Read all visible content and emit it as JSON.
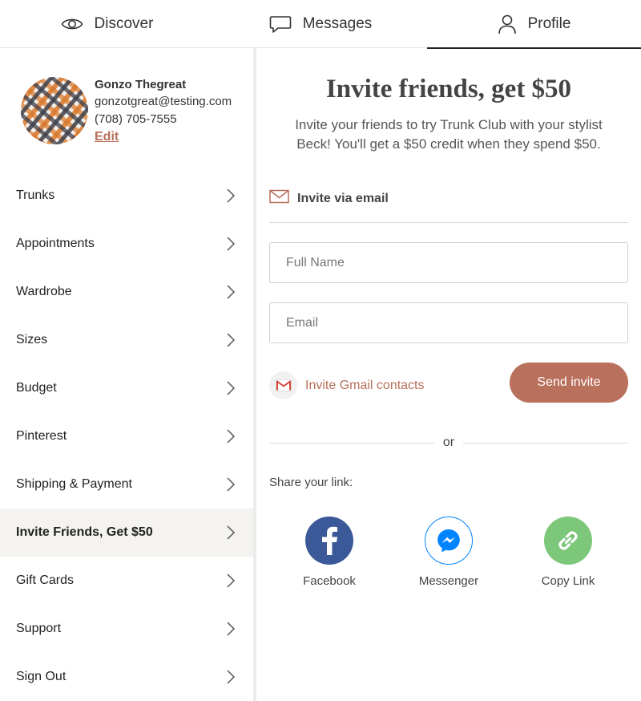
{
  "tabs": [
    {
      "label": "Discover",
      "icon": "eye-icon"
    },
    {
      "label": "Messages",
      "icon": "chat-bubble-icon"
    },
    {
      "label": "Profile",
      "icon": "person-icon",
      "active": true
    }
  ],
  "profile": {
    "name": "Gonzo Thegreat",
    "email": "gonzotgreat@testing.com",
    "phone": "(708) 705-7555",
    "edit_label": "Edit"
  },
  "menu": [
    {
      "label": "Trunks"
    },
    {
      "label": "Appointments"
    },
    {
      "label": "Wardrobe"
    },
    {
      "label": "Sizes"
    },
    {
      "label": "Budget"
    },
    {
      "label": "Pinterest"
    },
    {
      "label": "Shipping & Payment"
    },
    {
      "label": "Invite Friends, Get $50",
      "active": true
    },
    {
      "label": "Gift Cards"
    },
    {
      "label": "Support"
    },
    {
      "label": "Sign Out"
    }
  ],
  "invite": {
    "title": "Invite friends, get $50",
    "subtitle": "Invite your friends to try Trunk Club with your stylist Beck! You'll get a $50 credit when they spend $50.",
    "via_email_label": "Invite via email",
    "full_name_placeholder": "Full Name",
    "email_placeholder": "Email",
    "gmail_label": "Invite Gmail contacts",
    "send_label": "Send invite",
    "or_label": "or",
    "share_label": "Share your link:",
    "share_options": [
      {
        "label": "Facebook",
        "icon": "facebook-icon",
        "color": "#3b5998"
      },
      {
        "label": "Messenger",
        "icon": "messenger-icon",
        "color": "#0084ff"
      },
      {
        "label": "Copy Link",
        "icon": "link-icon",
        "color": "#7dc77a"
      }
    ]
  },
  "colors": {
    "accent": "#b9705c",
    "active_menu_bg": "#f4f3ef"
  }
}
